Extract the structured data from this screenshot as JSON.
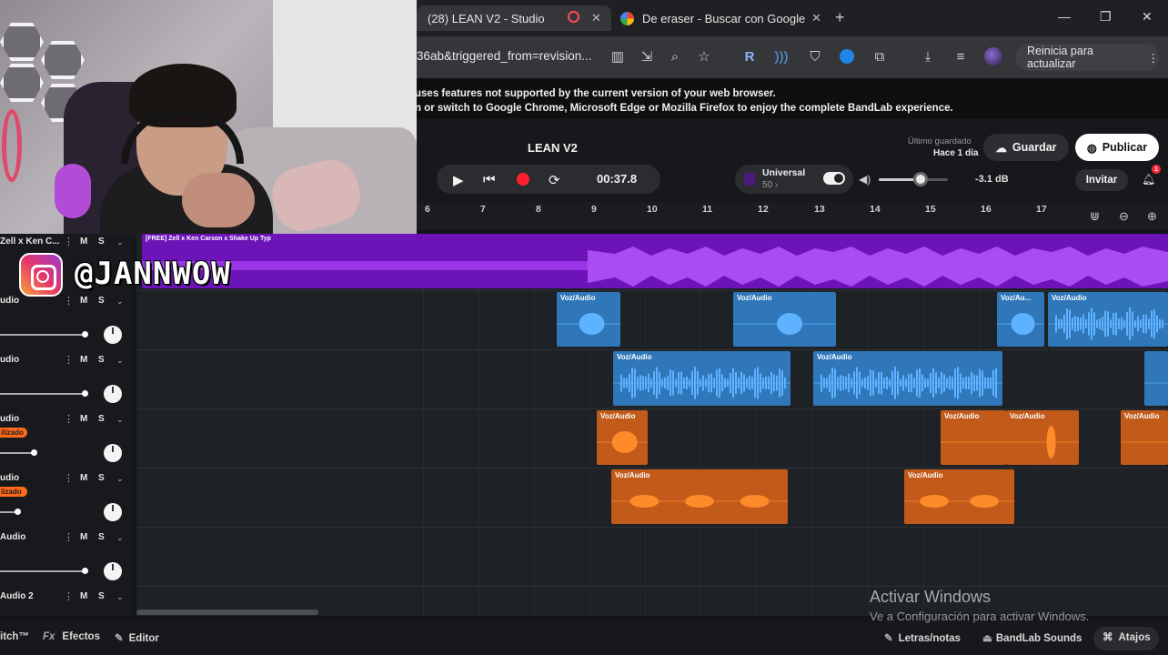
{
  "browser": {
    "tabs": [
      {
        "title": "(28) LEAN V2 - Studio",
        "active": true
      },
      {
        "title": "De eraser - Buscar con Google",
        "active": false
      }
    ],
    "url_fragment": "36ab&triggered_from=revision...",
    "update_button": "Reinicia para actualizar",
    "window_controls": [
      "minimize-icon",
      "restore-icon",
      "close-icon"
    ]
  },
  "warning": {
    "line1": "uses features not supported by the current version of your web browser.",
    "line2": "n or switch to Google Chrome, Microsoft Edge or Mozilla Firefox to enjoy the complete BandLab experience."
  },
  "studio": {
    "project_title": "LEAN V2",
    "time": "00:37.8",
    "instrument": {
      "name": "Universal",
      "sub": "50 ›"
    },
    "volume_db": "-3.1 dB",
    "volume_level": 0.6,
    "last_saved_label": "Último guardado",
    "last_saved_value": "Hace 1 día",
    "save_label": "Guardar",
    "publish_label": "Publicar",
    "invite_label": "Invitar",
    "notification_count": "1",
    "accent_record": "#ff1f30",
    "accent_blue": "#2f77b9",
    "accent_orange": "#c25a1a",
    "accent_purple": "#6c14b8"
  },
  "ruler": {
    "ticks": [
      "6",
      "7",
      "8",
      "9",
      "10",
      "11",
      "12",
      "13",
      "14",
      "15",
      "16",
      "17"
    ]
  },
  "tracks": [
    {
      "name": "Zell x Ken C...",
      "m": "M",
      "s": "S"
    },
    {
      "name": "udio",
      "m": "M",
      "s": "S"
    },
    {
      "name": "udio",
      "m": "M",
      "s": "S"
    },
    {
      "name": "udio",
      "m": "M",
      "s": "S",
      "badge": "ilizado"
    },
    {
      "name": "udio",
      "m": "M",
      "s": "S",
      "badge": "lizado"
    },
    {
      "name": "Audio",
      "m": "M",
      "s": "S"
    },
    {
      "name": "Audio 2",
      "m": "M",
      "s": "S"
    }
  ],
  "regions": {
    "beat_label": "[FREE] Zell x Ken Carson x Shake Up Typ",
    "vox_label": "Voz/Audio",
    "vox_short_label": "Voz/Au..."
  },
  "overlay": {
    "handle": "@JANNWOW"
  },
  "bottom": {
    "left_item": "itch™",
    "effects_label": "Efectos",
    "editor_label": "Editor",
    "lyrics_label": "Letras/notas",
    "sounds_label": "BandLab Sounds",
    "shortcuts_label": "Atajos"
  },
  "windows_watermark": {
    "line1": "Activar Windows",
    "line2": "Ve a Configuración para activar Windows."
  }
}
